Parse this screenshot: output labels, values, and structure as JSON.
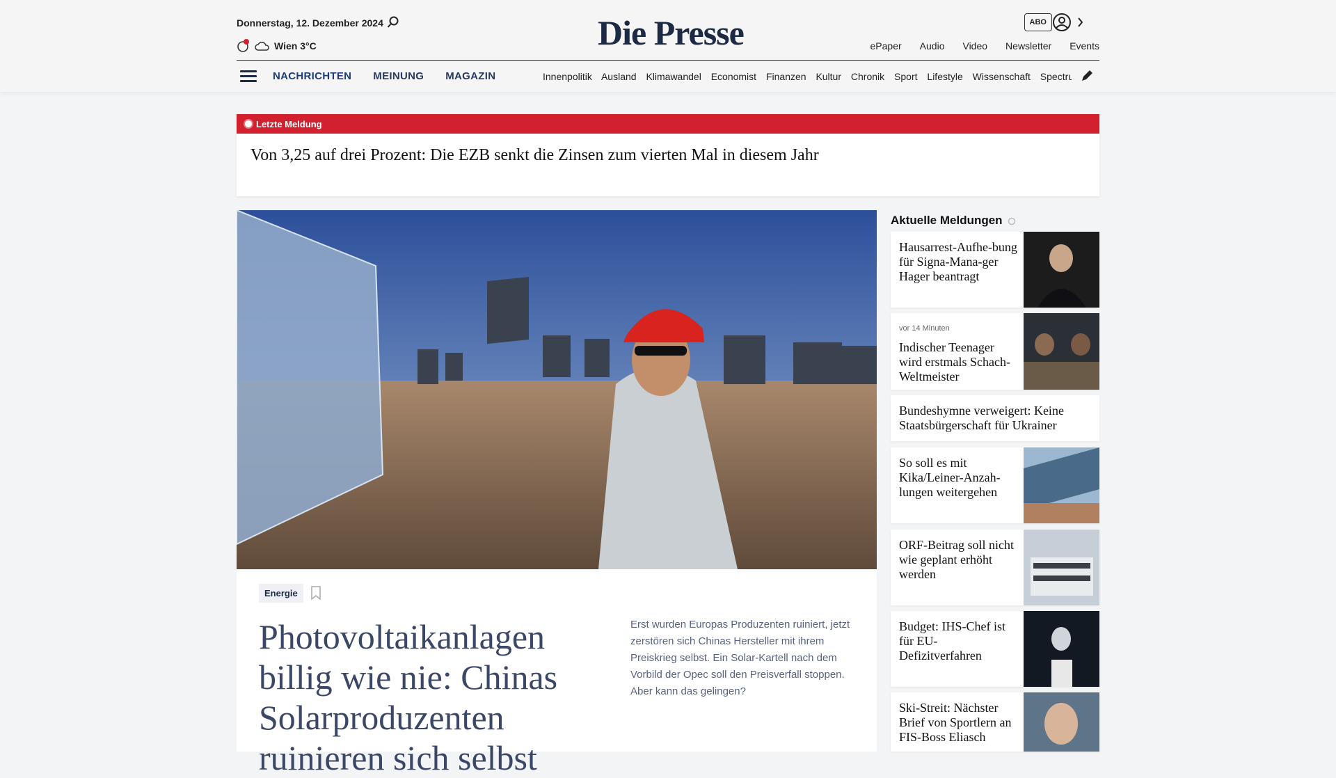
{
  "header": {
    "date": "Donnerstag, 12. Dezember 2024",
    "weather": "Wien 3°C",
    "logo": "Die Presse",
    "abo_label": "ABO",
    "top_links": [
      "ePaper",
      "Audio",
      "Video",
      "Newsletter",
      "Events"
    ]
  },
  "nav": {
    "main": [
      "NACHRICHTEN",
      "MEINUNG",
      "MAGAZIN"
    ],
    "sub": [
      "Innenpolitik",
      "Ausland",
      "Klimawandel",
      "Economist",
      "Finanzen",
      "Kultur",
      "Chronik",
      "Sport",
      "Lifestyle",
      "Wissenschaft",
      "Spectrum"
    ]
  },
  "breaking": {
    "label": "Letzte Meldung",
    "title": "Von 3,25 auf drei Prozent: Die EZB senkt die Zinsen zum vierten Mal in diesem Jahr"
  },
  "hero": {
    "tag": "Energie",
    "title": "Photovoltaikanlagen billig wie nie: Chinas Solarproduzenten ruinieren sich selbst",
    "lead": "Erst wurden Europas Produzenten ruiniert, jetzt zerstören sich Chinas Hersteller mit ihrem Preiskrieg selbst. Ein Solar-Kartell nach dem Vorbild der Opec soll den Preisverfall stoppen. Aber kann das gelingen?"
  },
  "sidebar": {
    "title": "Aktuelle Meldungen",
    "items": [
      {
        "text": "Hausarrest-Aufhe-bung für Signa-Mana-ger Hager beantragt",
        "ago": ""
      },
      {
        "text": "Indischer Teenager wird erstmals Schach-Weltmeister",
        "ago": "vor 14 Minuten"
      },
      {
        "text": "Bundeshymne verweigert: Keine Staatsbürgerschaft für Ukrainer",
        "ago": ""
      },
      {
        "text": "So soll es mit Kika/Leiner-Anzah-lungen weitergehen",
        "ago": ""
      },
      {
        "text": "ORF-Beitrag soll nicht wie geplant erhöht werden",
        "ago": ""
      },
      {
        "text": "Budget: IHS-Chef ist für EU-Defizitverfahren",
        "ago": ""
      },
      {
        "text": "Ski-Streit: Nächster Brief von Sportlern an FIS-Boss Eliasch",
        "ago": ""
      }
    ]
  },
  "colors": {
    "accent_red": "#d3202f",
    "navy": "#1d2a44"
  }
}
